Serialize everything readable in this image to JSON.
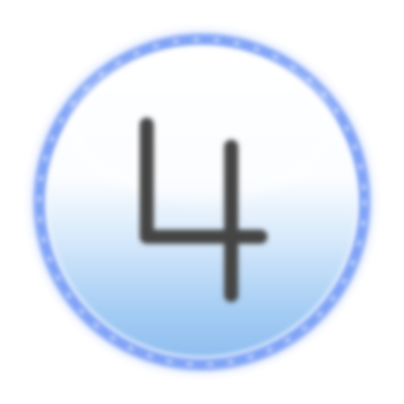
{
  "badge": {
    "digit": "4",
    "icon": "number-4-badge-icon",
    "colors": {
      "glyph": "#454545",
      "ring": "#7fa3f6",
      "inner_top": "#ffffff",
      "inner_bottom": "#8fbef0",
      "halo": "#c8d8ff"
    }
  }
}
